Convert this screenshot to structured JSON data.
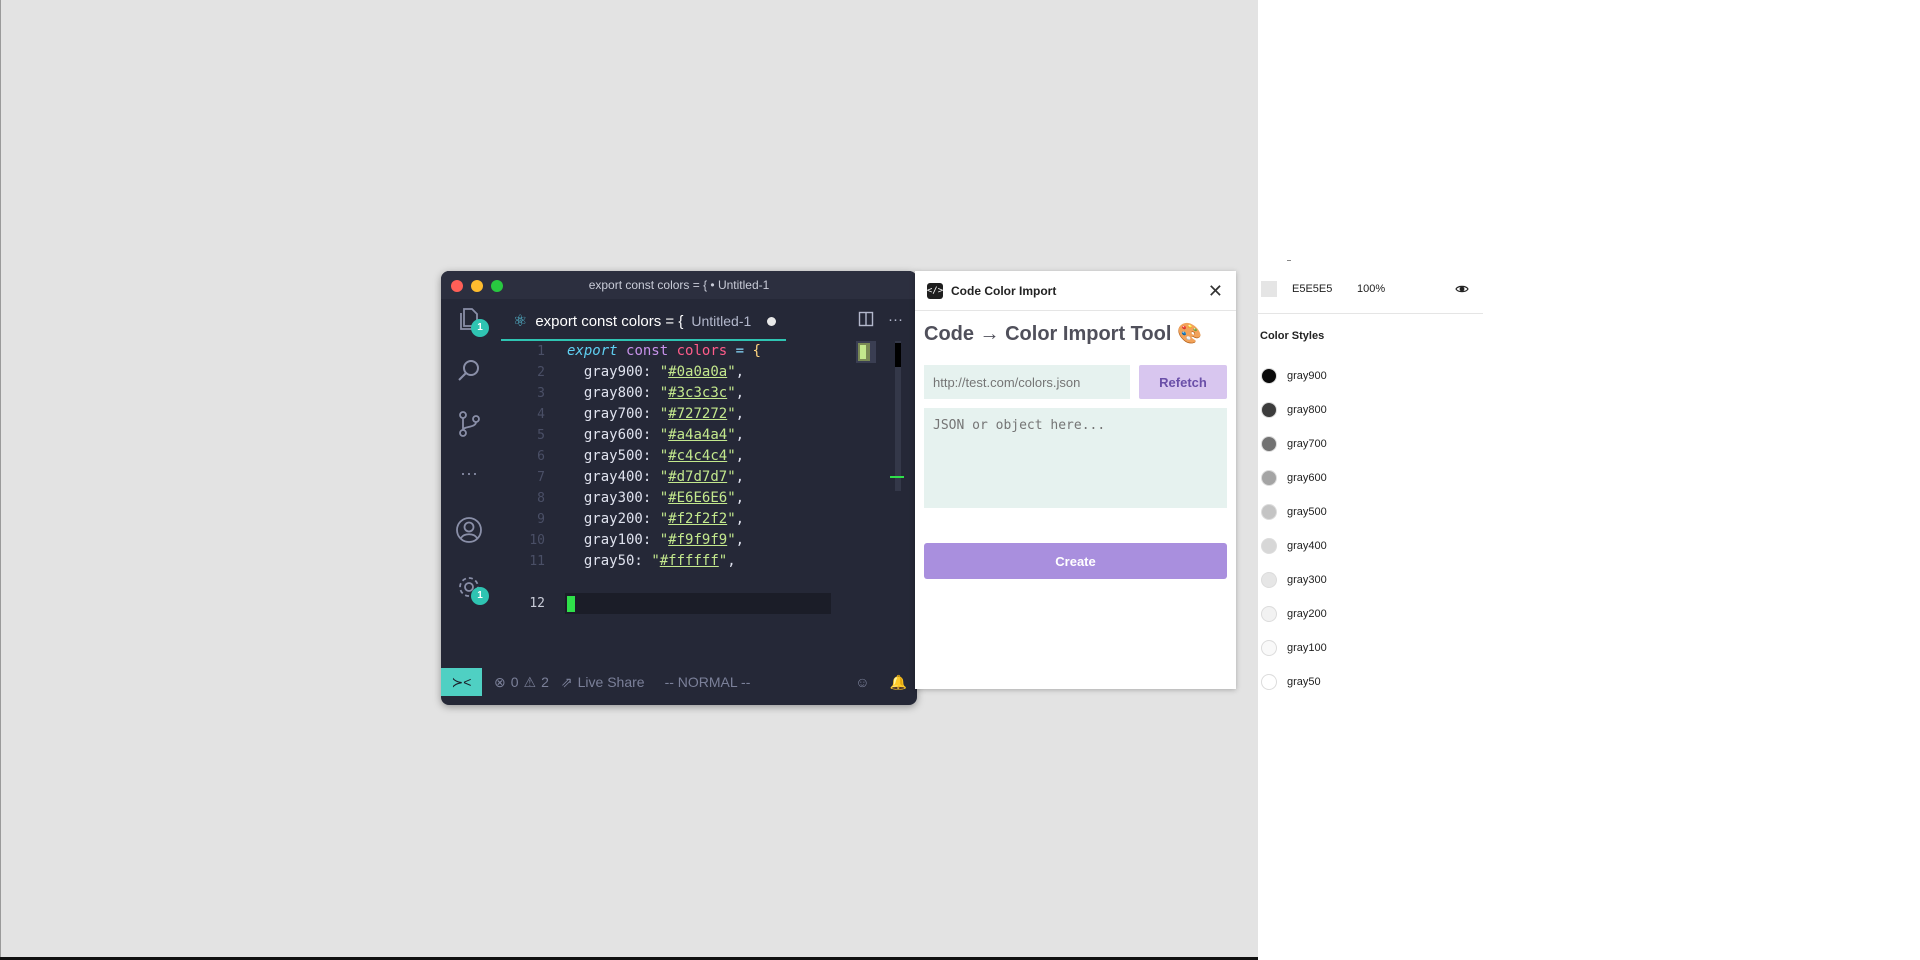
{
  "vscode": {
    "window_title": "export const colors = { • Untitled-1",
    "tab": {
      "title": "export const colors = {",
      "subtitle": "Untitled-1"
    },
    "badges": {
      "explorer": "1",
      "settings": "1"
    },
    "lines": [
      {
        "n": "1"
      },
      {
        "n": "2"
      },
      {
        "n": "3"
      },
      {
        "n": "4"
      },
      {
        "n": "5"
      },
      {
        "n": "6"
      },
      {
        "n": "7"
      },
      {
        "n": "8"
      },
      {
        "n": "9"
      },
      {
        "n": "10"
      },
      {
        "n": "11"
      },
      {
        "n": "12"
      }
    ],
    "code": {
      "export": "export",
      "const": "const",
      "colors": "colors",
      "eq": "=",
      "brace": "{",
      "entries": [
        {
          "key": "gray900:",
          "value": "#0a0a0a"
        },
        {
          "key": "gray800:",
          "value": "#3c3c3c"
        },
        {
          "key": "gray700:",
          "value": "#727272"
        },
        {
          "key": "gray600:",
          "value": "#a4a4a4"
        },
        {
          "key": "gray500:",
          "value": "#c4c4c4"
        },
        {
          "key": "gray400:",
          "value": "#d7d7d7"
        },
        {
          "key": "gray300:",
          "value": "#E6E6E6"
        },
        {
          "key": "gray200:",
          "value": "#f2f2f2"
        },
        {
          "key": "gray100:",
          "value": "#f9f9f9"
        },
        {
          "key": "gray50:",
          "value": "#ffffff"
        }
      ]
    },
    "status": {
      "errors": "0",
      "warnings": "2",
      "live_share": "Live Share",
      "mode": "-- NORMAL --"
    }
  },
  "plugin": {
    "name": "Code Color Import",
    "title": "Code → Color Import Tool 🎨",
    "url_placeholder": "http://test.com/colors.json",
    "refetch_label": "Refetch",
    "json_placeholder": "JSON or object here...",
    "create_label": "Create"
  },
  "properties": {
    "fill_hex": "E5E5E5",
    "fill_opacity": "100%",
    "color_styles_title": "Color Styles",
    "styles": [
      {
        "name": "gray900",
        "color": "#0a0a0a"
      },
      {
        "name": "gray800",
        "color": "#3c3c3c"
      },
      {
        "name": "gray700",
        "color": "#727272"
      },
      {
        "name": "gray600",
        "color": "#a4a4a4"
      },
      {
        "name": "gray500",
        "color": "#c4c4c4"
      },
      {
        "name": "gray400",
        "color": "#d7d7d7"
      },
      {
        "name": "gray300",
        "color": "#e6e6e6"
      },
      {
        "name": "gray200",
        "color": "#f2f2f2"
      },
      {
        "name": "gray100",
        "color": "#f9f9f9"
      },
      {
        "name": "gray50",
        "color": "#ffffff"
      }
    ]
  }
}
